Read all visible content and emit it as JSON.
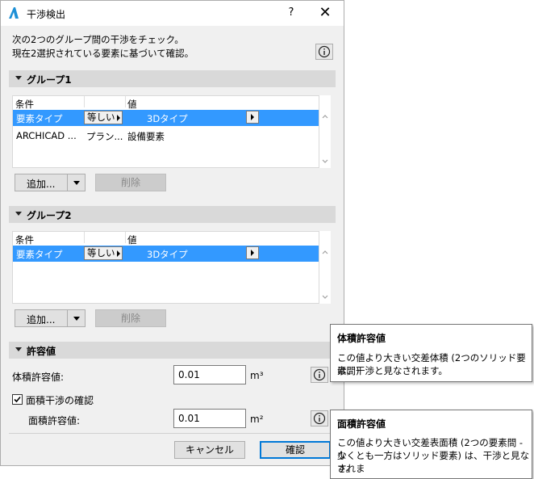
{
  "window": {
    "title": "干渉検出",
    "help_label": "?",
    "close_label": "✕"
  },
  "description": {
    "line1": "次の2つのグループ間の干渉をチェック。",
    "line2": "現在2選択されている要素に基づいて確認。"
  },
  "group1": {
    "header": "グループ1",
    "col_condition": "条件",
    "col_value": "値",
    "rows": [
      {
        "condition": "要素タイプ",
        "operator": "等しい",
        "value": "3Dタイプ"
      },
      {
        "condition": "ARCHICAD ...",
        "operator": "プラン...",
        "value": "設備要素"
      }
    ],
    "add_label": "追加...",
    "delete_label": "削除"
  },
  "group2": {
    "header": "グループ2",
    "col_condition": "条件",
    "col_value": "値",
    "rows": [
      {
        "condition": "要素タイプ",
        "operator": "等しい",
        "value": "3Dタイプ"
      }
    ],
    "add_label": "追加...",
    "delete_label": "削除"
  },
  "tolerance": {
    "header": "許容値",
    "volume_label": "体積許容値:",
    "volume_value": "0.01",
    "volume_unit": "m³",
    "surface_checkbox_label": "面積干渉の確認",
    "surface_checked": true,
    "surface_label": "面積許容値:",
    "surface_value": "0.01",
    "surface_unit": "m²"
  },
  "buttons": {
    "cancel": "キャンセル",
    "confirm": "確認"
  },
  "tooltip_volume": {
    "title": "体積許容値",
    "line1": "この値より大きい交差体積 (2つのソリッド要素間)",
    "line2": "は、干渉と見なされます。"
  },
  "tooltip_surface": {
    "title": "面積許容値",
    "line1": "この値より大きい交差表面積 (2つの要素間 - 少",
    "line2": "なくとも一方はソリッド要素) は、干渉と見なされま",
    "line3": "す。"
  },
  "colors": {
    "selection": "#3399ff",
    "accent": "#0078d7",
    "app_icon": "#1e90d6"
  }
}
